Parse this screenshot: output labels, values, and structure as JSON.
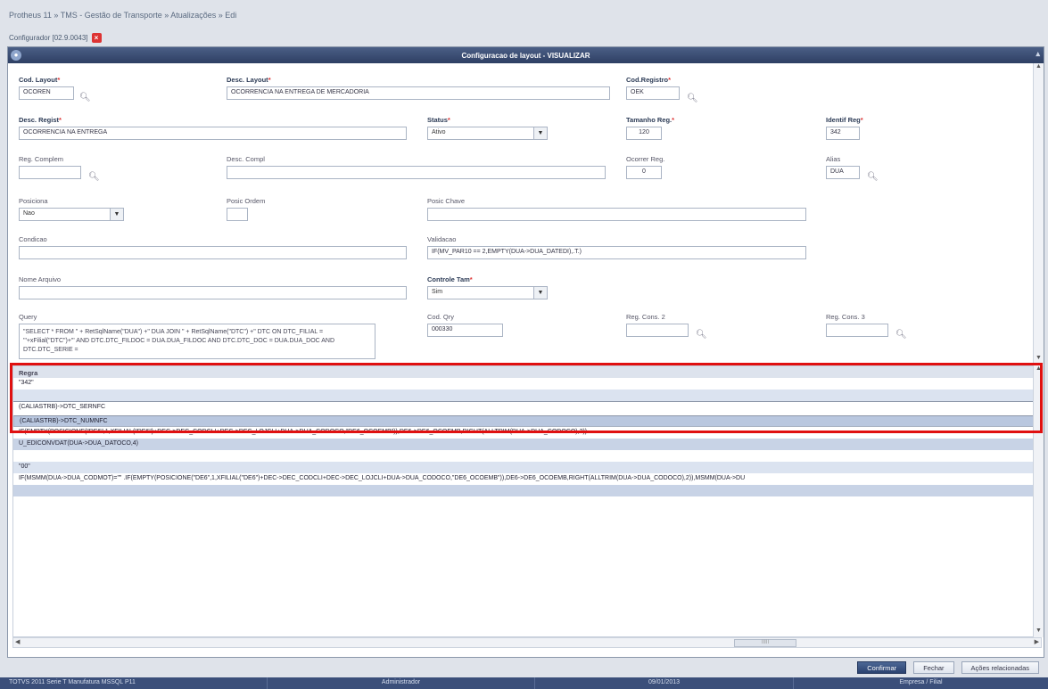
{
  "app": {
    "breadcrumb": "Protheus 11 » TMS - Gestão de Transporte » Atualizações » Edi",
    "configurator": "Configurador [02.9.0043]"
  },
  "window": {
    "title": "Configuracao de layout - VISUALIZAR"
  },
  "form": {
    "cod_layout": {
      "label": "Cod. Layout",
      "value": "OCOREN"
    },
    "desc_layout": {
      "label": "Desc. Layout",
      "value": "OCORRENCIA NA ENTREGA DE MERCADORIA"
    },
    "cod_registro": {
      "label": "Cod.Registro",
      "value": "OEK"
    },
    "desc_regist": {
      "label": "Desc. Regist",
      "value": "OCORRENCIA NA ENTREGA"
    },
    "status": {
      "label": "Status",
      "value": "Ativo"
    },
    "tamanho_reg": {
      "label": "Tamanho Reg.",
      "value": "120"
    },
    "identif_reg": {
      "label": "Identif Reg",
      "value": "342"
    },
    "reg_complem": {
      "label": "Reg. Complem",
      "value": ""
    },
    "desc_compl": {
      "label": "Desc. Compl",
      "value": ""
    },
    "ocorrer_reg": {
      "label": "Ocorrer Reg.",
      "value": "0"
    },
    "alias": {
      "label": "Alias",
      "value": "DUA"
    },
    "posiciona": {
      "label": "Posiciona",
      "value": "Nao"
    },
    "posic_ordem": {
      "label": "Posic Ordem",
      "value": ""
    },
    "posic_chave": {
      "label": "Posic Chave",
      "value": ""
    },
    "condicao": {
      "label": "Condicao",
      "value": ""
    },
    "validacao": {
      "label": "Validacao",
      "value": "IF(MV_PAR10 == 2,EMPTY(DUA->DUA_DATEDI),.T.)"
    },
    "nome_arquivo": {
      "label": "Nome Arquivo",
      "value": ""
    },
    "controle_tam": {
      "label": "Controle Tam",
      "value": "Sim"
    },
    "query": {
      "label": "Query",
      "value": "\"SELECT * FROM \" + RetSqlName(\"DUA\") +\" DUA JOIN \" + RetSqlName(\"DTC\") +\" DTC ON DTC_FILIAL = '\"+xFilial(\"DTC\")+\"' AND DTC.DTC_FILDOC = DUA.DUA_FILDOC AND DTC.DTC_DOC = DUA.DUA_DOC AND DTC.DTC_SERIE ="
    },
    "cod_qry": {
      "label": "Cod. Qry",
      "value": "000330"
    },
    "reg_cons2": {
      "label": "Reg. Cons. 2",
      "value": ""
    },
    "reg_cons3": {
      "label": "Reg. Cons. 3",
      "value": ""
    }
  },
  "grid": {
    "header": "Regra",
    "rows": [
      "\"342\"",
      "",
      "(CALIASTRB)->DTC_SERNFC",
      "(CALIASTRB)->DTC_NUMNFC",
      "IF(EMPTY(POSICIONE(\"DE6\",1,XFILIAL(\"DE6\")+DEC->DEC_CODCLI+DEC->DEC_LOJCLI+DUA->DUA_CODOCO,\"DE6_OCOEMB\")),DE6->DE6_OCOEMB,RIGHT(ALLTRIM(DUA->DUA_CODOCO),2))",
      "U_EDICONVDAT(DUA->DUA_DATOCO,4)",
      "",
      "\"00\"",
      "IF(MSMM(DUA->DUA_CODMOT)=\"\" .IF(EMPTY(POSICIONE(\"DE6\",1,XFILIAL(\"DE6\")+DEC->DEC_CODCLI+DEC->DEC_LOJCLI+DUA->DUA_CODOCO,\"DE6_OCOEMB\")),DE6->DE6_OCOEMB,RIGHT(ALLTRIM(DUA->DUA_CODOCO),2)),MSMM(DUA->DU",
      ""
    ],
    "hscroll_label": "IIIII"
  },
  "buttons": {
    "confirm": "Confirmar",
    "close": "Fechar",
    "related_actions": "Ações relacionadas"
  },
  "status_bar": {
    "company": "TOTVS 2011 Serie T Manufatura MSSQL P11",
    "user": "Administrador",
    "date": "09/01/2013",
    "module": "Empresa / Filial"
  }
}
